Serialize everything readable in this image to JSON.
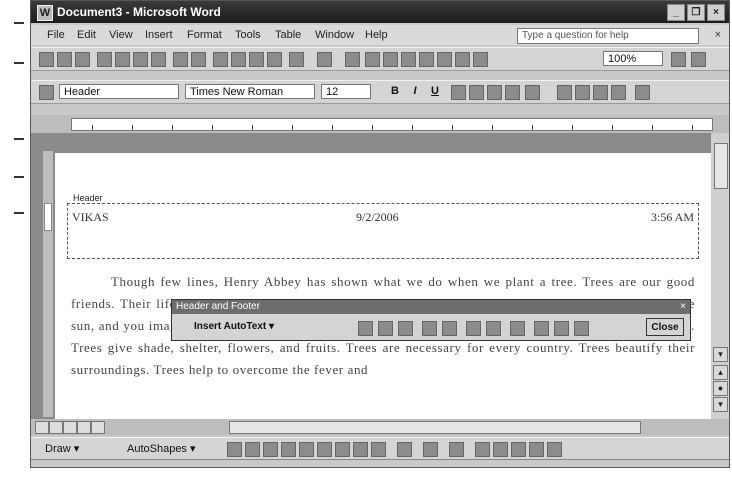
{
  "window": {
    "title": "Document3 - Microsoft Word"
  },
  "menu": {
    "items": [
      "File",
      "Edit",
      "View",
      "Insert",
      "Format",
      "Tools",
      "Table",
      "Window",
      "Help"
    ],
    "ask_placeholder": "Type a question for help",
    "close_glyph": "×"
  },
  "standard_toolbar": {
    "zoom": "100%"
  },
  "formatting_toolbar": {
    "style": "Header",
    "font": "Times New Roman",
    "size": "12"
  },
  "document": {
    "header_label": "Header",
    "header": {
      "left": "VIKAS",
      "center": "9/2/2006",
      "right": "3:56 AM"
    },
    "paragraph": "Though few lines, Henry Abbey has shown what we do when we plant a tree. Trees are our good friends. Their life depends on the tree. Many of men's needs come from trees. Trees are shelter from the sun, and you imagine the use of such things ? Trees supply most of men's needs. Trees are blessing to men. Trees give shade, shelter, flowers, and fruits. Trees are necessary for every country. Trees beautify their surroundings. Trees help to overcome the fever and"
  },
  "hf_toolbar": {
    "title": "Header and Footer",
    "insert_autotext": "Insert AutoText ▾",
    "close_label": "Close"
  },
  "drawing_toolbar": {
    "draw_label": "Draw ▾",
    "autoshapes_label": "AutoShapes ▾"
  }
}
